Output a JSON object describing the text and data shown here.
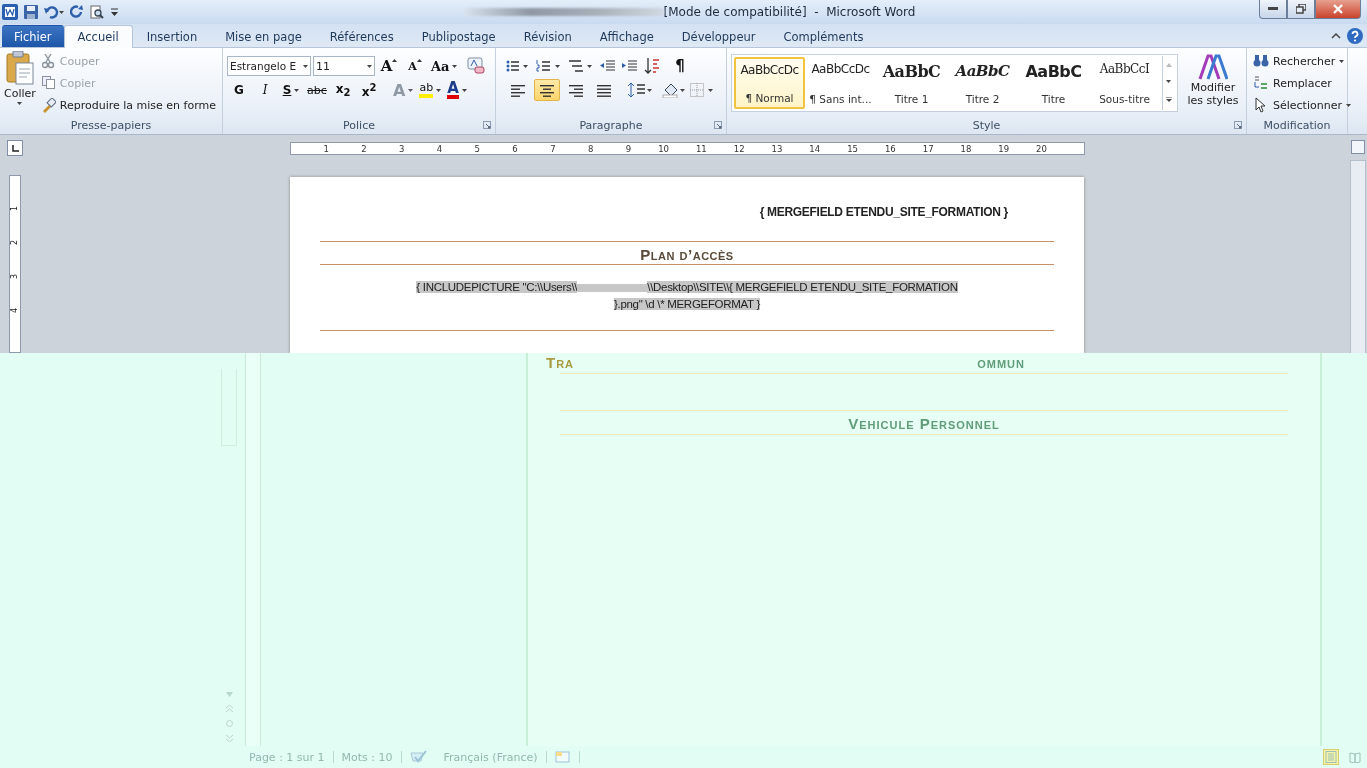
{
  "window": {
    "title": "[Mode de compatibilité]  -  Microsoft Word"
  },
  "tabs": [
    {
      "label": "Fichier",
      "kind": "file",
      "selected": false
    },
    {
      "label": "Accueil",
      "kind": "tab",
      "selected": true
    },
    {
      "label": "Insertion",
      "kind": "tab",
      "selected": false
    },
    {
      "label": "Mise en page",
      "kind": "tab",
      "selected": false
    },
    {
      "label": "Références",
      "kind": "tab",
      "selected": false
    },
    {
      "label": "Publipostage",
      "kind": "tab",
      "selected": false
    },
    {
      "label": "Révision",
      "kind": "tab",
      "selected": false
    },
    {
      "label": "Affichage",
      "kind": "tab",
      "selected": false
    },
    {
      "label": "Développeur",
      "kind": "tab",
      "selected": false
    },
    {
      "label": "Compléments",
      "kind": "tab",
      "selected": false
    }
  ],
  "clipboard": {
    "title": "Presse-papiers",
    "paste": "Coller",
    "items": [
      {
        "label": "Couper",
        "kind": "cut",
        "disabled": true
      },
      {
        "label": "Copier",
        "kind": "copy",
        "disabled": true
      },
      {
        "label": "Reproduire la mise en forme",
        "kind": "painter",
        "disabled": false
      }
    ]
  },
  "font": {
    "title": "Police",
    "name": "Estrangelo E",
    "size": "11",
    "row1": [
      {
        "label": "A",
        "kind": "grow"
      },
      {
        "label": "A",
        "kind": "shrink"
      },
      {
        "label": "Aa",
        "kind": "case"
      }
    ],
    "row2": [
      {
        "label": "G",
        "kind": "bold",
        "disabled": false
      },
      {
        "label": "I",
        "kind": "italic",
        "disabled": false
      },
      {
        "label": "S",
        "kind": "underline",
        "disabled": false
      },
      {
        "label": "abc",
        "kind": "strike",
        "disabled": false
      },
      {
        "label": "x$_{2}$",
        "kind": "sub",
        "disabled": false
      },
      {
        "label": "x$^{2}$",
        "kind": "sup",
        "disabled": false
      },
      {
        "label": "A",
        "kind": "effects",
        "disabled": true
      },
      {
        "label": "ab",
        "kind": "highlight",
        "disabled": false
      },
      {
        "label": "A",
        "kind": "color",
        "disabled": false
      }
    ]
  },
  "paragraph": {
    "title": "Paragraphe",
    "pilcrow": "¶",
    "alignments": [
      {
        "selected": false
      },
      {
        "selected": true
      },
      {
        "selected": false
      },
      {
        "selected": false
      }
    ]
  },
  "styles": {
    "title": "Style",
    "change": "Modifier les styles",
    "items": [
      {
        "sample": "AaBbCcDc",
        "label": "¶ Normal",
        "kind": "normal",
        "selected": true
      },
      {
        "sample": "AaBbCcDc",
        "label": "¶ Sans int...",
        "kind": "normal",
        "selected": false
      },
      {
        "sample": "AaBbC",
        "label": "Titre 1",
        "kind": "heading1",
        "selected": false
      },
      {
        "sample": "AaBbC",
        "label": "Titre 2",
        "kind": "heading2",
        "selected": false
      },
      {
        "sample": "AaBbC",
        "label": "Titre",
        "kind": "title",
        "selected": false
      },
      {
        "sample": "AaBbCcI",
        "label": "Sous-titre",
        "kind": "subtitle",
        "selected": false
      }
    ]
  },
  "editing": {
    "title": "Modification",
    "items": [
      {
        "label": "Rechercher",
        "kind": "find"
      },
      {
        "label": "Remplacer",
        "kind": "replace"
      },
      {
        "label": "Sélectionner",
        "kind": "select"
      }
    ]
  },
  "ruler": {
    "numbers": [
      "1",
      "2",
      "3",
      "4",
      "5",
      "6",
      "7",
      "8",
      "9",
      "10",
      "11",
      "12",
      "13",
      "14",
      "15",
      "16",
      "17",
      "18",
      "19",
      "20"
    ]
  },
  "vertical_ruler": {
    "numbers": [
      "1",
      "2",
      "3",
      "4"
    ]
  },
  "document": {
    "header_field": "{ MERGEFIELD ETENDU_SITE_FORMATION }",
    "heading": "Plan d’accès",
    "field_code": {
      "before": "{ INCLUDEPICTURE \"C:\\\\Users\\\\",
      "middle": "\\\\Desktop\\\\SITE\\\\{ MERGEFIELD ETENDU_SITE_FORMATION",
      "end": "}.png\" \\d  \\* MERGEFORMAT }"
    }
  },
  "lower": {
    "heading_fragments": [
      "Tra",
      "ommun"
    ],
    "heading": "Vehicule Personnel"
  },
  "status_bar": {
    "page": "Page : 1 sur 1",
    "words": "Mots : 10",
    "language": "Français (France)",
    "views": [
      {
        "selected": true
      },
      {
        "selected": false
      }
    ]
  }
}
